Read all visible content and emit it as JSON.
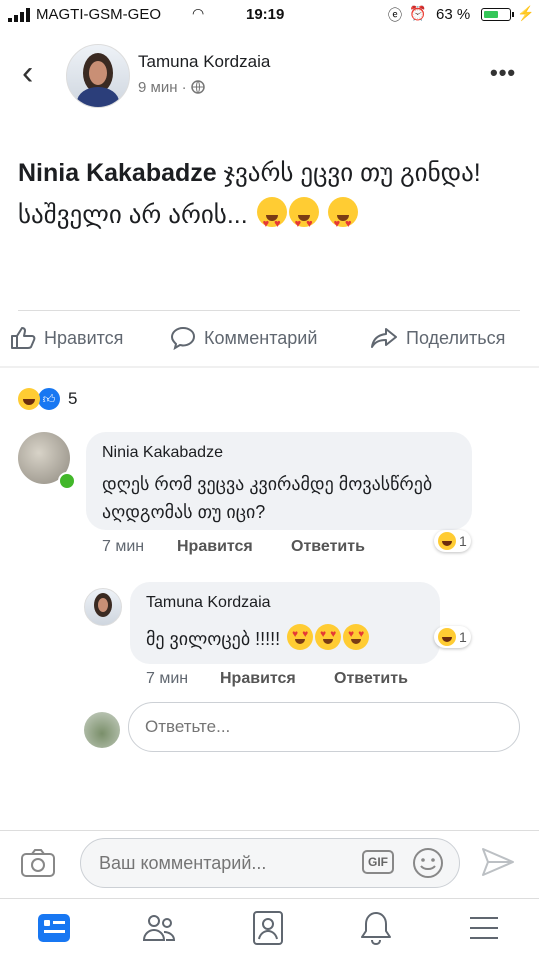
{
  "status_bar": {
    "carrier": "MAGTI-GSM-GEO",
    "time": "19:19",
    "battery": "63 %",
    "battery_level": 0.63
  },
  "header": {
    "author": "Tamuna Kordzaia",
    "meta": "9 мин · ",
    "back_icon": "chevron-left-icon",
    "more_icon": "more-horizontal-icon"
  },
  "post": {
    "bold": "Ninia Kakabadze",
    "text": " ჯვარს ეცვი თუ გინდა! საშველი არ არის... "
  },
  "actions": {
    "like": "Нравится",
    "comment": "Комментарий",
    "share": "Поделиться"
  },
  "reactions": {
    "count": "5"
  },
  "comments": [
    {
      "name": "Ninia Kakabadze",
      "text": "დღეს რომ ვეცვა კვირამდე მოვასწრებ აღდგომას თუ იცი?",
      "time": "7 мин",
      "like": "Нравится",
      "reply": "Ответить",
      "reaction_count": "1"
    },
    {
      "name": "Tamuna Kordzaia",
      "text": "მე ვილოცებ !!!!! ",
      "time": "7 мин",
      "like": "Нравится",
      "reply": "Ответить",
      "reaction_count": "1"
    }
  ],
  "reply_box": {
    "placeholder": "Ответьте..."
  },
  "composer": {
    "placeholder": "Ваш комментарий...",
    "gif": "GIF"
  },
  "colors": {
    "accent": "#1877f2",
    "online": "#42b72a",
    "emoji": "#ffcc33"
  }
}
